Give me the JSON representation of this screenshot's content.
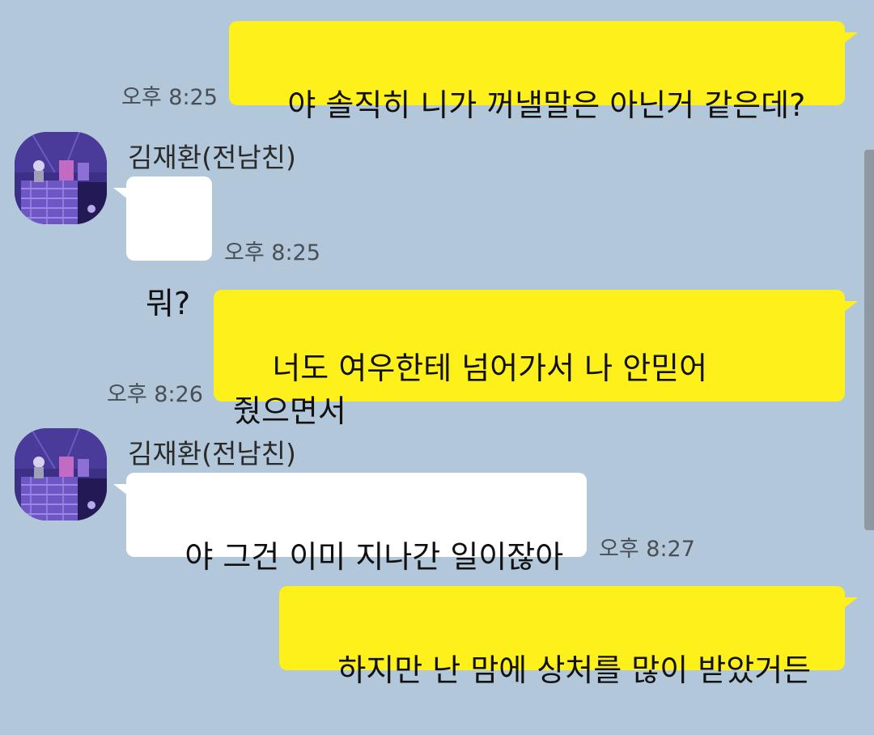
{
  "messages": [
    {
      "from": "me",
      "text": "야 솔직히 니가 꺼낼말은 아닌거 같은데?",
      "time": "오후 8:25"
    },
    {
      "from": "other",
      "sender": "김재환(전남친)",
      "text": "뭐?",
      "time": "오후 8:25"
    },
    {
      "from": "me",
      "text": "너도 여우한테 넘어가서 나 안믿어\n줬으면서",
      "time": "오후 8:26"
    },
    {
      "from": "other",
      "sender": "김재환(전남친)",
      "text": "야 그건 이미 지나간 일이잖아",
      "time": "오후 8:27"
    },
    {
      "from": "me",
      "text": "하지만 난 맘에 상처를 많이 받았거든",
      "time": ""
    }
  ],
  "colors": {
    "background": "#b2c7da",
    "my_bubble": "#fef01b",
    "other_bubble": "#ffffff"
  },
  "icons": {
    "avatar": "profile-illustration-icon"
  }
}
